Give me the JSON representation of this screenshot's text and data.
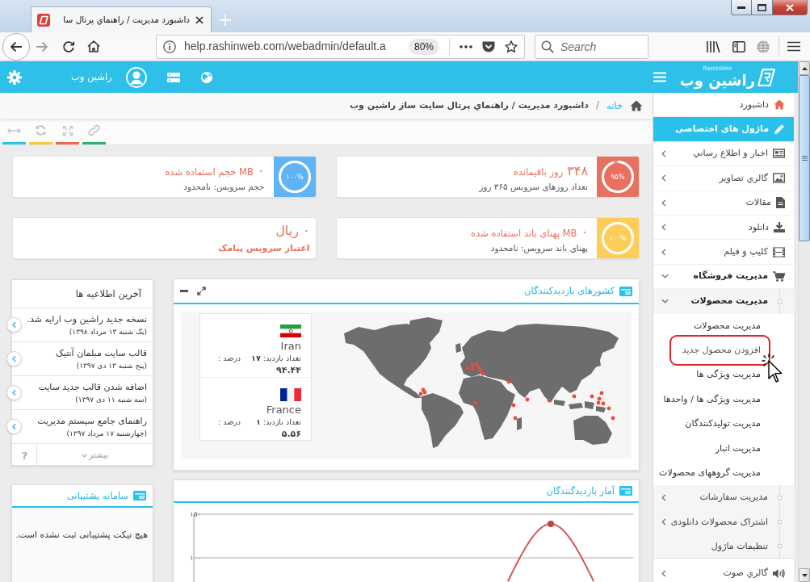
{
  "browser": {
    "tab_title": "داشبورد مديريت / راهنماي پرتال سا",
    "url": "help.rashinweb.com/webadmin/default.a",
    "zoom": "80%",
    "search_placeholder": "Search"
  },
  "header": {
    "logo": "راشین وب",
    "logo_tagline": "RashinWeb",
    "user_name": "راشین وب"
  },
  "breadcrumb": {
    "home": "خانه",
    "separator": "/",
    "current": "داشبورد مديريت / راهنماي پرتال سایت ساز راشین وب"
  },
  "toolbar": [
    {
      "color": "#29c1ea"
    },
    {
      "color": "#fdc735"
    },
    {
      "color": "#f0654d"
    },
    {
      "color": "#27b46f"
    }
  ],
  "stats": [
    {
      "kind": "ring",
      "color": "#e8705f",
      "level": 0.95,
      "percent": "۹۵%",
      "value": "۳۴۸",
      "label": "روز باقیمانده",
      "note": "تعداد روزهای سرویس ۳۶۵ روز"
    },
    {
      "kind": "ring",
      "color": "#5fb3f6",
      "level": 1,
      "percent": "۱۰۰%",
      "value": "۰",
      "label": "MB حجم استفاده شده",
      "note": "حجم سرویس: نامحدود"
    },
    {
      "kind": "ring",
      "color": "#fecd57",
      "level": 1,
      "percent": "۱۰۰%",
      "value": "۰",
      "label": "MB پهنای باند استفاده شده",
      "note": "پهنای باند سرویس: نامحدود"
    },
    {
      "kind": "plain",
      "value": "۰",
      "label": "ریال",
      "note": "اعتبار سرویس پیامک"
    }
  ],
  "visitor_countries": {
    "title": "کشورهای بازدیدکنندگان",
    "countries": [
      {
        "name": "Iran",
        "visits": "تعداد بازدید: **۱۷**",
        "percent_label": "درصد :",
        "percent": "۹۴.۴۴"
      },
      {
        "name": "France",
        "visits": "تعداد بازدید: **۱**",
        "percent_label": "درصد :",
        "percent": "۵.۵۶"
      }
    ]
  },
  "notifications": {
    "title": "آخرین اطلاعیه ها",
    "items": [
      {
        "title": "نسخه جدید راشین وب ارایه شد.",
        "date": "(یک شنبه ۱۳ مرداد ۱۳۹۸)"
      },
      {
        "title": "قالب سایت مبلمان آنتیک",
        "date": "(پنج شنبه ۱۳ دی ۱۳۹۷)"
      },
      {
        "title": "اضافه شدن قالب جدید سایت",
        "date": "(سه شنبه ۱۱ دی ۱۳۹۷)"
      },
      {
        "title": "راهنمای جامع سیستم مدیریت",
        "date": "(چهارشنبه ۱۷ مرداد ۱۳۹۷)"
      }
    ],
    "more": "بیشتر",
    "help": "?"
  },
  "visitor_stats": {
    "title": "آمار بازدیدگنندگان",
    "y_axis_labels": [
      "۱۵۰",
      "۱۰۰"
    ]
  },
  "support": {
    "title": "سامانه پشتیبانی",
    "message": "هیچ تیکت پشتیبانی ثبت نشده است."
  },
  "sidebar": {
    "items": [
      {
        "label": "داشبورد",
        "kind": "link",
        "selected": false,
        "expanded": false
      },
      {
        "label": "ماژول های اختصاصی",
        "kind": "link",
        "selected": true,
        "expanded": false
      },
      {
        "label": "اخبار و اطلاع رساني",
        "kind": "menu",
        "selected": false,
        "expanded": false
      },
      {
        "label": "گالري تصاوير",
        "kind": "menu",
        "selected": false,
        "expanded": false
      },
      {
        "label": "مقالات",
        "kind": "menu",
        "selected": false,
        "expanded": false
      },
      {
        "label": "دانلود",
        "kind": "menu",
        "selected": false,
        "expanded": false
      },
      {
        "label": "كليپ و فيلم",
        "kind": "menu",
        "selected": false,
        "expanded": false
      },
      {
        "label": "مديريت فروشگاه",
        "kind": "menu",
        "selected": false,
        "expanded": true,
        "children": [
          {
            "label": "مديريت محصولات",
            "kind": "menu",
            "selected": false,
            "expanded": true,
            "children": [
              {
                "label": "مديريت محصولات",
                "selected": false,
                "highlighted": false
              },
              {
                "label": "افزودن محصول جدید",
                "selected": false,
                "highlighted": true
              },
              {
                "label": "مديريت ويژگی ها",
                "selected": false,
                "highlighted": false
              },
              {
                "label": "مديريت ويژگی ها / واحدها",
                "selected": false,
                "highlighted": false
              },
              {
                "label": "مديريت توليدكنندگان",
                "selected": false,
                "highlighted": false
              },
              {
                "label": "مديريت انبار",
                "selected": false,
                "highlighted": false
              },
              {
                "label": "مديريت گروههای محصولات",
                "selected": false,
                "highlighted": false
              }
            ]
          },
          {
            "label": "مديريت سفارشات",
            "kind": "menu",
            "selected": false,
            "expanded": false
          },
          {
            "label": "اشتراک محصولات دانلودی",
            "kind": "menu",
            "selected": false,
            "expanded": false
          },
          {
            "label": "تنظيمات ماژول",
            "kind": "link",
            "selected": false,
            "expanded": false
          }
        ]
      },
      {
        "label": "گالري صوت",
        "kind": "menu",
        "selected": false,
        "expanded": false
      }
    ]
  }
}
